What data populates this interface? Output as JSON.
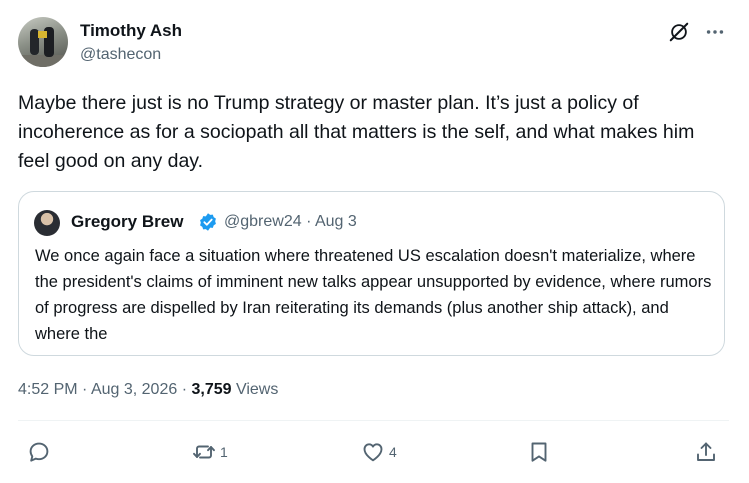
{
  "author": {
    "name": "Timothy Ash",
    "handle": "@tashecon"
  },
  "tweet": {
    "text": "Maybe there just is no Trump strategy or master plan. It’s just a policy of incoherence as for a sociopath all that matters is the self, and what makes him feel good on any day."
  },
  "quote": {
    "name": "Gregory Brew",
    "handle": "@gbrew24",
    "separator": "·",
    "date": "Aug 3",
    "text": "We once again face a situation where threatened US escalation doesn't materialize, where the president's claims of imminent new talks appear unsupported by evidence, where rumors of progress are dispelled by Iran reiterating its demands (plus another ship attack), and where the"
  },
  "meta": {
    "time": "4:52 PM",
    "date": "Aug 3, 2026",
    "separator": "·",
    "views_count": "3,759",
    "views_label": "Views"
  },
  "actions": {
    "reposts": "1",
    "likes": "4"
  },
  "icons": [
    "grok-icon",
    "more-icon",
    "verified-badge-icon",
    "reply-icon",
    "repost-icon",
    "like-icon",
    "bookmark-icon",
    "share-icon"
  ],
  "colors": {
    "text": "#0f1419",
    "secondary": "#536471",
    "border": "#cfd9de",
    "verified": "#1d9bf0"
  }
}
